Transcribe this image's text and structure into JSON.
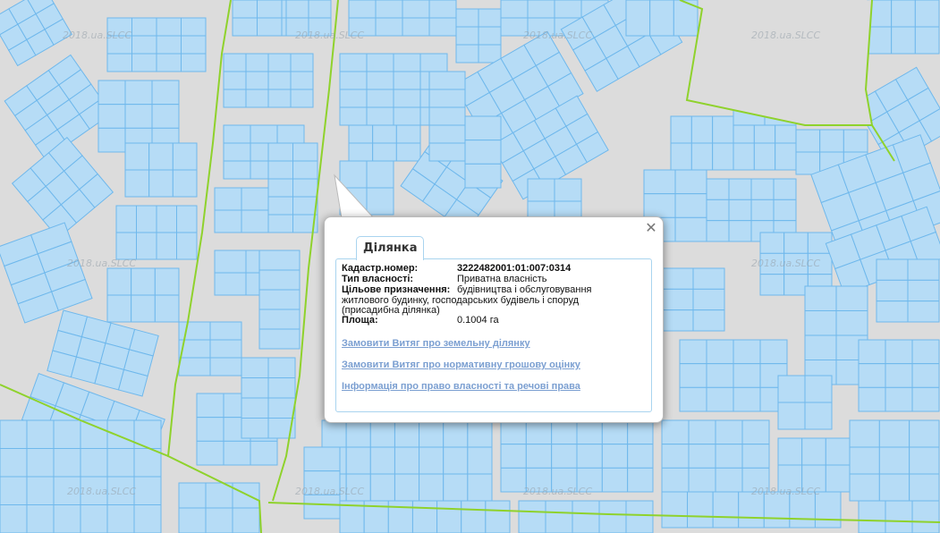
{
  "map": {
    "watermark_text": "2018.ua.SLCC",
    "parcel_fill": "#b6dcf6",
    "parcel_stroke": "#6fb8ec",
    "boundary_color": "#8fd22c",
    "background": "#dcdcdc"
  },
  "popup": {
    "tab_label": "Ділянка",
    "close_glyph": "✕",
    "fields": {
      "cadastral_label": "Кадастр.номер:",
      "cadastral_value": "3222482001:01:007:0314",
      "ownership_label": "Тип власності:",
      "ownership_value": "Приватна власність",
      "purpose_label": "Цільове призначення:",
      "purpose_value_line1": "будівництва і обслуговування",
      "purpose_value_rest": "житлового будинку, господарських будівель і споруд (присадибна ділянка)",
      "area_label": "Площа:",
      "area_value": "0.1004 га"
    },
    "links": [
      "Замовити Витяг про земельну ділянку",
      "Замовити Витяг про нормативну грошову оцінку",
      "Інформація про право власності та речові права"
    ]
  }
}
